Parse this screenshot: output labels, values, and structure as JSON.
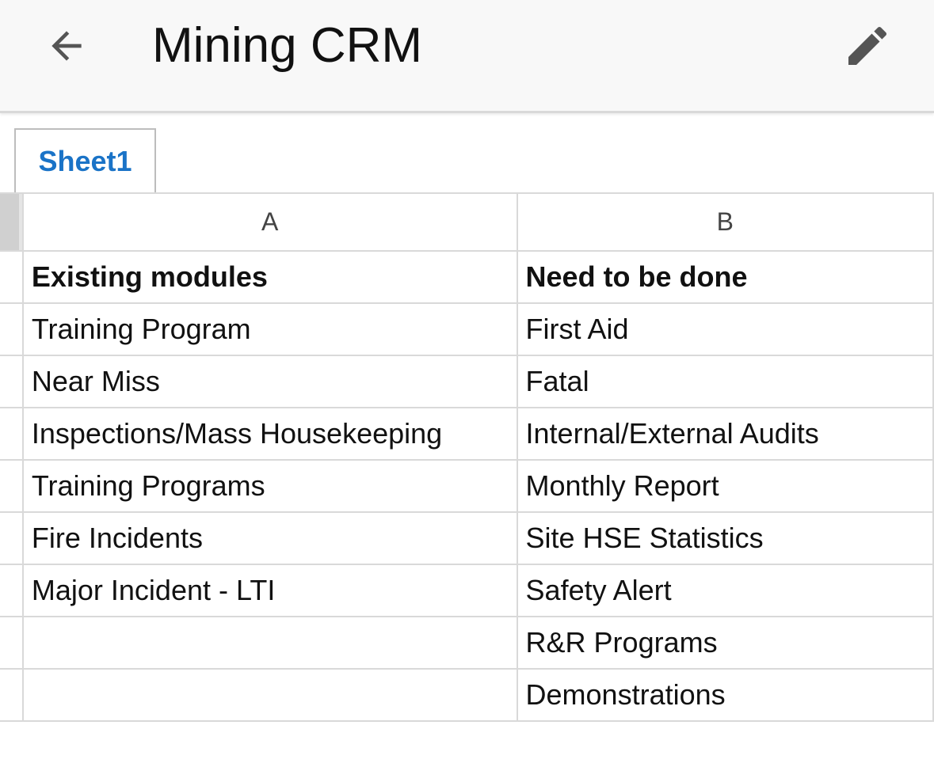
{
  "app": {
    "title": "Mining CRM",
    "back_icon": "arrow-back-icon",
    "edit_icon": "pencil-edit-icon"
  },
  "tabs": [
    {
      "label": "Sheet1",
      "active": true,
      "color": "#1a73c7"
    }
  ],
  "sheet": {
    "columns": [
      "A",
      "B"
    ],
    "rows": [
      [
        "Existing modules",
        "Need to be done"
      ],
      [
        "Training Program",
        "First Aid"
      ],
      [
        "Near Miss",
        "Fatal"
      ],
      [
        "Inspections/Mass Housekeeping",
        "Internal/External Audits"
      ],
      [
        "Training Programs",
        "Monthly Report"
      ],
      [
        "Fire Incidents",
        "Site HSE Statistics"
      ],
      [
        "Major Incident - LTI",
        "Safety Alert"
      ],
      [
        "",
        "R&R Programs"
      ],
      [
        "",
        "Demonstrations"
      ]
    ]
  }
}
